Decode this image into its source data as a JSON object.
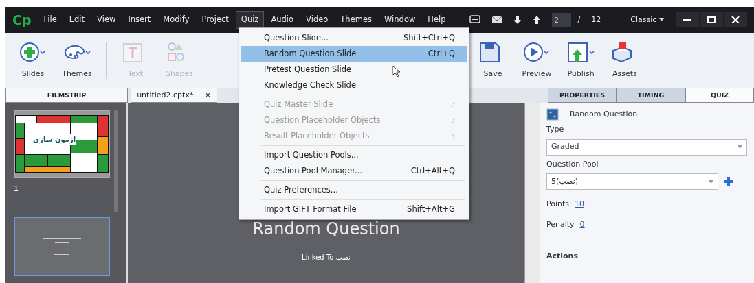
{
  "menubar": {
    "logo": "Cp",
    "items": [
      {
        "label": "File",
        "selected": false
      },
      {
        "label": "Edit",
        "selected": false
      },
      {
        "label": "View",
        "selected": false
      },
      {
        "label": "Insert",
        "selected": false
      },
      {
        "label": "Modify",
        "selected": false
      },
      {
        "label": "Project",
        "selected": false
      },
      {
        "label": "Quiz",
        "selected": true
      },
      {
        "label": "Audio",
        "selected": false
      },
      {
        "label": "Video",
        "selected": false
      },
      {
        "label": "Themes",
        "selected": false
      },
      {
        "label": "Window",
        "selected": false
      },
      {
        "label": "Help",
        "selected": false
      }
    ],
    "page_value": "2",
    "page_separator": "/",
    "page_total": "12",
    "workspace": "Classic"
  },
  "toolbar": [
    {
      "kind": "slides",
      "label": "Slides",
      "disabled": false
    },
    {
      "kind": "themes",
      "label": "Themes",
      "disabled": false
    },
    {
      "kind": "text",
      "label": "Text",
      "disabled": true
    },
    {
      "kind": "shapes",
      "label": "Shapes",
      "disabled": true
    },
    {
      "kind": "save",
      "label": "Save",
      "disabled": false
    },
    {
      "kind": "preview",
      "label": "Preview",
      "disabled": false
    },
    {
      "kind": "publish",
      "label": "Publish",
      "disabled": false
    },
    {
      "kind": "assets",
      "label": "Assets",
      "disabled": false
    }
  ],
  "filmstrip": {
    "title": "FILMSTRIP",
    "slides": [
      {
        "kind": "title",
        "number": "1",
        "caption": "آزمون سازی",
        "selected": false
      },
      {
        "kind": "question",
        "selected": true
      }
    ]
  },
  "document_tab": {
    "label": "untitled2.cptx*",
    "close": "×"
  },
  "stage": {
    "title": "Random Question",
    "linked": "Linked To نصب"
  },
  "menu": {
    "groups": [
      [
        {
          "label": "Question Slide...",
          "shortcut": "Shift+Ctrl+Q",
          "selected": false,
          "disabled": false,
          "submenu": false
        },
        {
          "label": "Random Question Slide",
          "shortcut": "Ctrl+Q",
          "selected": true,
          "disabled": false,
          "submenu": false
        },
        {
          "label": "Pretest Question Slide",
          "selected": false,
          "disabled": false,
          "submenu": false
        },
        {
          "label": "Knowledge Check Slide",
          "selected": false,
          "disabled": false,
          "submenu": false
        }
      ],
      [
        {
          "label": "Quiz Master Slide",
          "selected": false,
          "disabled": true,
          "submenu": true
        },
        {
          "label": "Question Placeholder Objects",
          "selected": false,
          "disabled": true,
          "submenu": true
        },
        {
          "label": "Result Placeholder Objects",
          "selected": false,
          "disabled": true,
          "submenu": true
        }
      ],
      [
        {
          "label": "Import Question Pools...",
          "selected": false,
          "disabled": false,
          "submenu": false
        },
        {
          "label": "Question Pool Manager...",
          "shortcut": "Ctrl+Alt+Q",
          "selected": false,
          "disabled": false,
          "submenu": false
        }
      ],
      [
        {
          "label": "Quiz Preferences...",
          "selected": false,
          "disabled": false,
          "submenu": false
        }
      ],
      [
        {
          "label": "Import GIFT Format File",
          "shortcut": "Shift+Alt+G",
          "selected": false,
          "disabled": false,
          "submenu": false
        }
      ]
    ]
  },
  "panel_tabs": [
    {
      "label": "PROPERTIES",
      "selected": false
    },
    {
      "label": "TIMING",
      "selected": false
    },
    {
      "label": "QUIZ",
      "selected": true
    }
  ],
  "properties": {
    "header": "Random Question",
    "type_label": "Type",
    "type_value": "Graded",
    "pool_label": "Question Pool",
    "pool_value": "5(نصب)",
    "points_label": "Points",
    "points_value": "10",
    "penalty_label": "Penalty",
    "penalty_value": "0",
    "actions": "Actions"
  }
}
